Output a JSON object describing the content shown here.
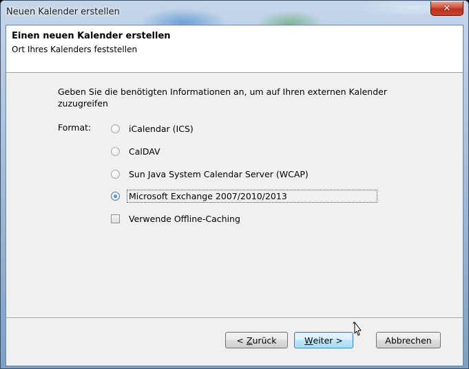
{
  "window": {
    "title": "Neuen Kalender erstellen",
    "close_glyph": "✕"
  },
  "header": {
    "title": "Einen neuen Kalender erstellen",
    "subtitle": "Ort Ihres Kalenders feststellen"
  },
  "body": {
    "instructions": "Geben Sie die benötigten Informationen an, um auf Ihren externen Kalender zuzugreifen",
    "format_label": "Format:",
    "options": [
      {
        "label": "iCalendar (ICS)",
        "type": "radio",
        "checked": false
      },
      {
        "label": "CalDAV",
        "type": "radio",
        "checked": false
      },
      {
        "label": "Sun Java System Calendar Server (WCAP)",
        "type": "radio",
        "checked": false
      },
      {
        "label": "Microsoft Exchange 2007/2010/2013",
        "type": "radio",
        "checked": true
      },
      {
        "label": "Verwende Offline-Caching",
        "type": "checkbox",
        "checked": false
      }
    ]
  },
  "footer": {
    "back_prefix": "< ",
    "back_accel": "Z",
    "back_rest": "urück",
    "next_accel": "W",
    "next_rest": "eiter >",
    "cancel": "Abbrechen"
  },
  "icons": {
    "close": "close-icon",
    "cursor": "mouse-pointer-icon"
  },
  "colors": {
    "default_button_border": "#3c7fb1",
    "close_button": "#c8432d"
  }
}
